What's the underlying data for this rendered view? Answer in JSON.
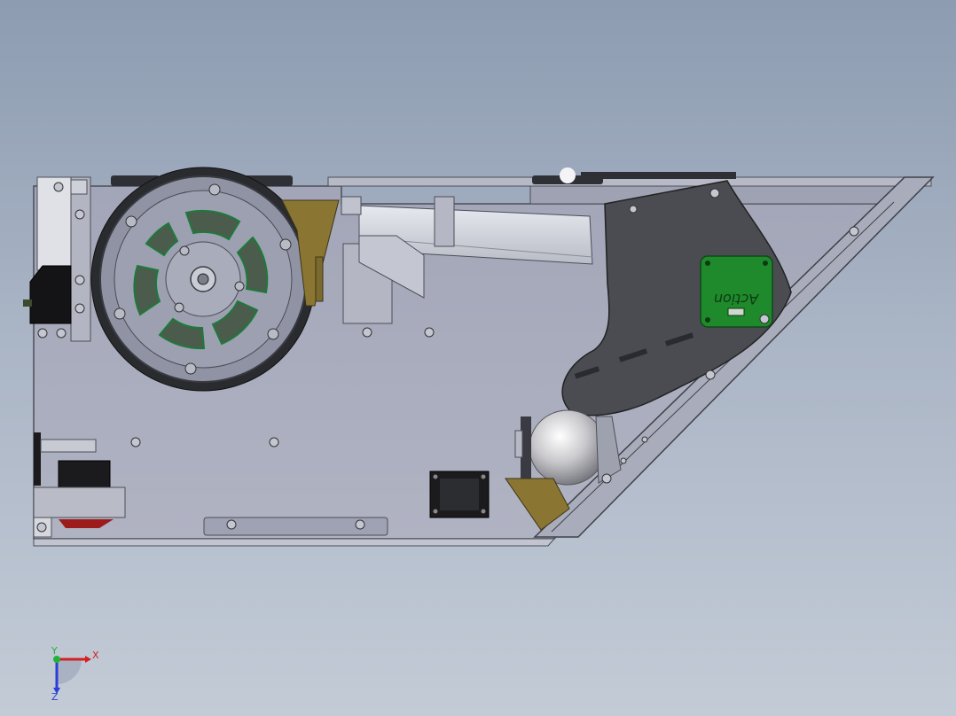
{
  "viewport": {
    "background_top": "#8d9cb1",
    "background_bottom": "#c3cbd6"
  },
  "model": {
    "board_text": "Action",
    "board_color": "#1f8a2c",
    "plate_color": "#a6a9ba",
    "bracket_color": "#8a7632",
    "shroud_color": "#4a4c52"
  },
  "triad": {
    "x_label": "X",
    "y_label": "Y",
    "z_label": "Z",
    "x_color": "#d42020",
    "y_color": "#1fb33a",
    "z_color": "#2a3fd6"
  }
}
